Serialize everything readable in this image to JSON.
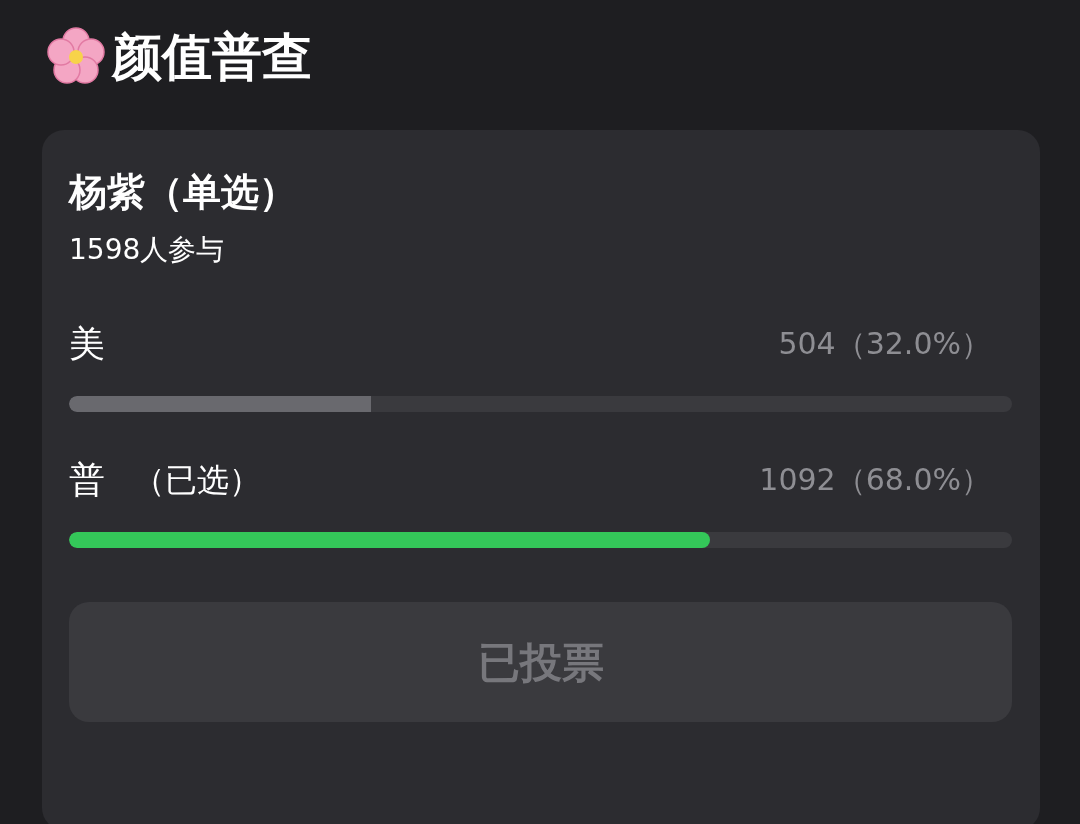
{
  "header": {
    "title": "颜值普查"
  },
  "poll": {
    "title": "杨紫（单选）",
    "participants": "1598人参与",
    "options": [
      {
        "label": "美",
        "result": "504（32.0%）",
        "level": 0.32,
        "selected": false
      },
      {
        "label": "普",
        "note": "（已选）",
        "result": "1092（68.0%）",
        "level": 0.68,
        "selected": true
      }
    ],
    "button": {
      "label": "已投票",
      "disabled": true
    }
  }
}
